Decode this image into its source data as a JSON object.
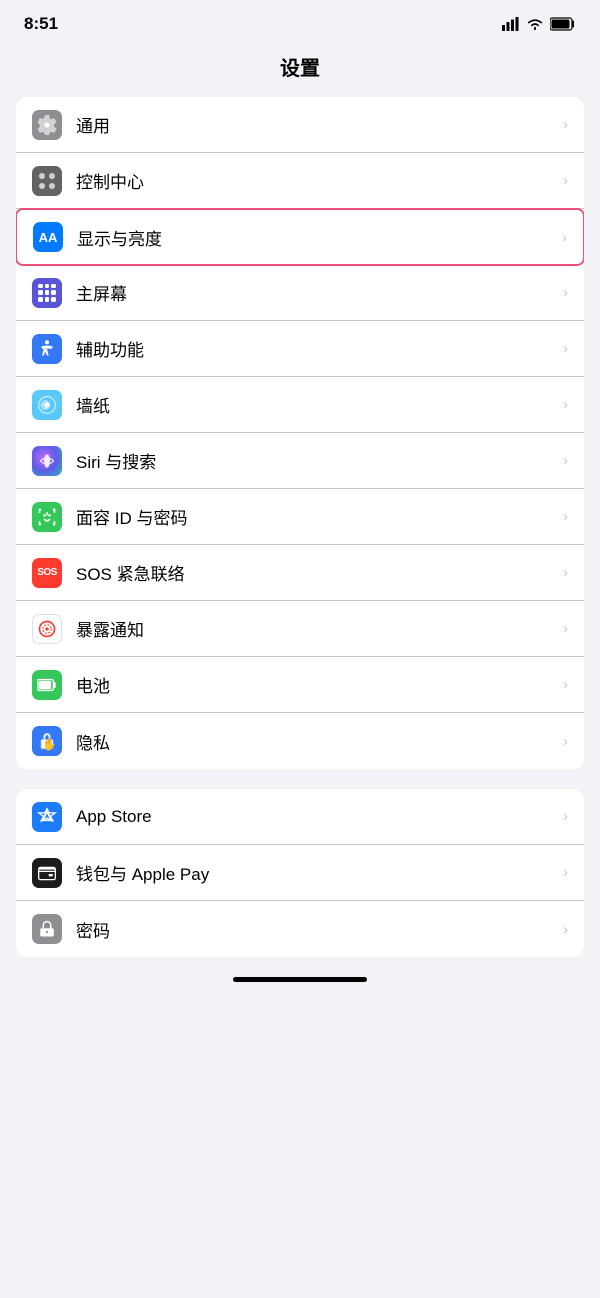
{
  "statusBar": {
    "time": "8:51"
  },
  "header": {
    "title": "设置"
  },
  "groups": [
    {
      "id": "general-group",
      "items": [
        {
          "id": "tongyong",
          "label": "通用",
          "iconBg": "bg-gray",
          "iconType": "gear",
          "highlighted": false
        },
        {
          "id": "kongzhizhongxin",
          "label": "控制中心",
          "iconBg": "bg-gray2",
          "iconType": "toggle",
          "highlighted": false
        },
        {
          "id": "xianshiliang",
          "label": "显示与亮度",
          "iconBg": "bg-blue",
          "iconType": "aa",
          "highlighted": true
        },
        {
          "id": "zhupingmu",
          "label": "主屏幕",
          "iconBg": "bg-indigo",
          "iconType": "grid",
          "highlighted": false
        },
        {
          "id": "fuzhugongneng",
          "label": "辅助功能",
          "iconBg": "bg-blue2",
          "iconType": "person",
          "highlighted": false
        },
        {
          "id": "qiangzhi",
          "label": "墙纸",
          "iconBg": "bg-teal",
          "iconType": "flower",
          "highlighted": false
        },
        {
          "id": "siri",
          "label": "Siri 与搜索",
          "iconBg": "bg-siri",
          "iconType": "siri",
          "highlighted": false
        },
        {
          "id": "mianrong",
          "label": "面容 ID 与密码",
          "iconBg": "bg-green",
          "iconType": "faceid",
          "highlighted": false
        },
        {
          "id": "sos",
          "label": "SOS 紧急联络",
          "iconBg": "bg-red",
          "iconType": "sos",
          "highlighted": false
        },
        {
          "id": "baolu",
          "label": "暴露通知",
          "iconBg": "bg-white-red",
          "iconType": "exposure",
          "highlighted": false
        },
        {
          "id": "dianci",
          "label": "电池",
          "iconBg": "bg-green",
          "iconType": "battery",
          "highlighted": false
        },
        {
          "id": "yinsi",
          "label": "隐私",
          "iconBg": "bg-blue2",
          "iconType": "hand",
          "highlighted": false
        }
      ]
    },
    {
      "id": "apps-group",
      "items": [
        {
          "id": "appstore",
          "label": "App Store",
          "iconBg": "bg-blue",
          "iconType": "appstore",
          "highlighted": false
        },
        {
          "id": "wallet",
          "label": "钱包与 Apple Pay",
          "iconBg": "bg-dark",
          "iconType": "wallet",
          "highlighted": false
        },
        {
          "id": "password",
          "label": "密码",
          "iconBg": "bg-gray",
          "iconType": "key",
          "highlighted": false,
          "partial": true
        }
      ]
    }
  ]
}
